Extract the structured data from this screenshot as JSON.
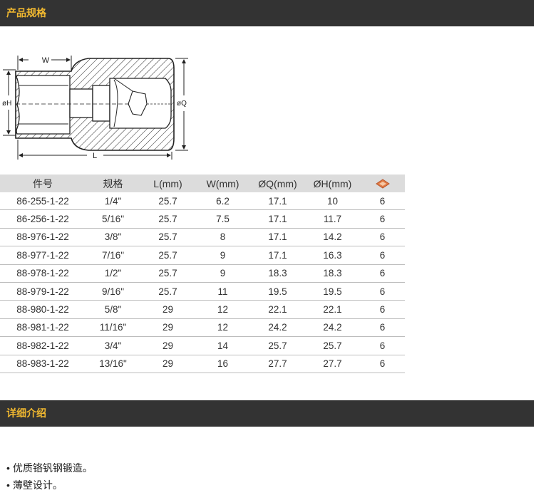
{
  "section_spec": {
    "title": "产品规格"
  },
  "diagram": {
    "label_w": "W",
    "label_h": "øH",
    "label_q": "øQ",
    "label_l": "L"
  },
  "table": {
    "headers": [
      "件号",
      "规格",
      "L(mm)",
      "W(mm)",
      "ØQ(mm)",
      "ØH(mm)"
    ],
    "last_header_icon": "hex-point-icon",
    "rows": [
      [
        "86-255-1-22",
        "1/4\"",
        "25.7",
        "6.2",
        "17.1",
        "10",
        "6"
      ],
      [
        "86-256-1-22",
        "5/16\"",
        "25.7",
        "7.5",
        "17.1",
        "11.7",
        "6"
      ],
      [
        "88-976-1-22",
        "3/8\"",
        "25.7",
        "8",
        "17.1",
        "14.2",
        "6"
      ],
      [
        "88-977-1-22",
        "7/16\"",
        "25.7",
        "9",
        "17.1",
        "16.3",
        "6"
      ],
      [
        "88-978-1-22",
        "1/2\"",
        "25.7",
        "9",
        "18.3",
        "18.3",
        "6"
      ],
      [
        "88-979-1-22",
        "9/16\"",
        "25.7",
        "11",
        "19.5",
        "19.5",
        "6"
      ],
      [
        "88-980-1-22",
        "5/8\"",
        "29",
        "12",
        "22.1",
        "22.1",
        "6"
      ],
      [
        "88-981-1-22",
        "11/16\"",
        "29",
        "12",
        "24.2",
        "24.2",
        "6"
      ],
      [
        "88-982-1-22",
        "3/4\"",
        "29",
        "14",
        "25.7",
        "25.7",
        "6"
      ],
      [
        "88-983-1-22",
        "13/16\"",
        "29",
        "16",
        "27.7",
        "27.7",
        "6"
      ]
    ]
  },
  "section_detail": {
    "title": "详细介绍"
  },
  "details": [
    {
      "bullet": "•",
      "text": "优质铬钒钢锻造。"
    },
    {
      "bullet": "•",
      "text": "薄壁设计。"
    }
  ],
  "colors": {
    "bar_bg": "#333333",
    "bar_text": "#f0b830",
    "header_bg": "#dcdcdc"
  }
}
